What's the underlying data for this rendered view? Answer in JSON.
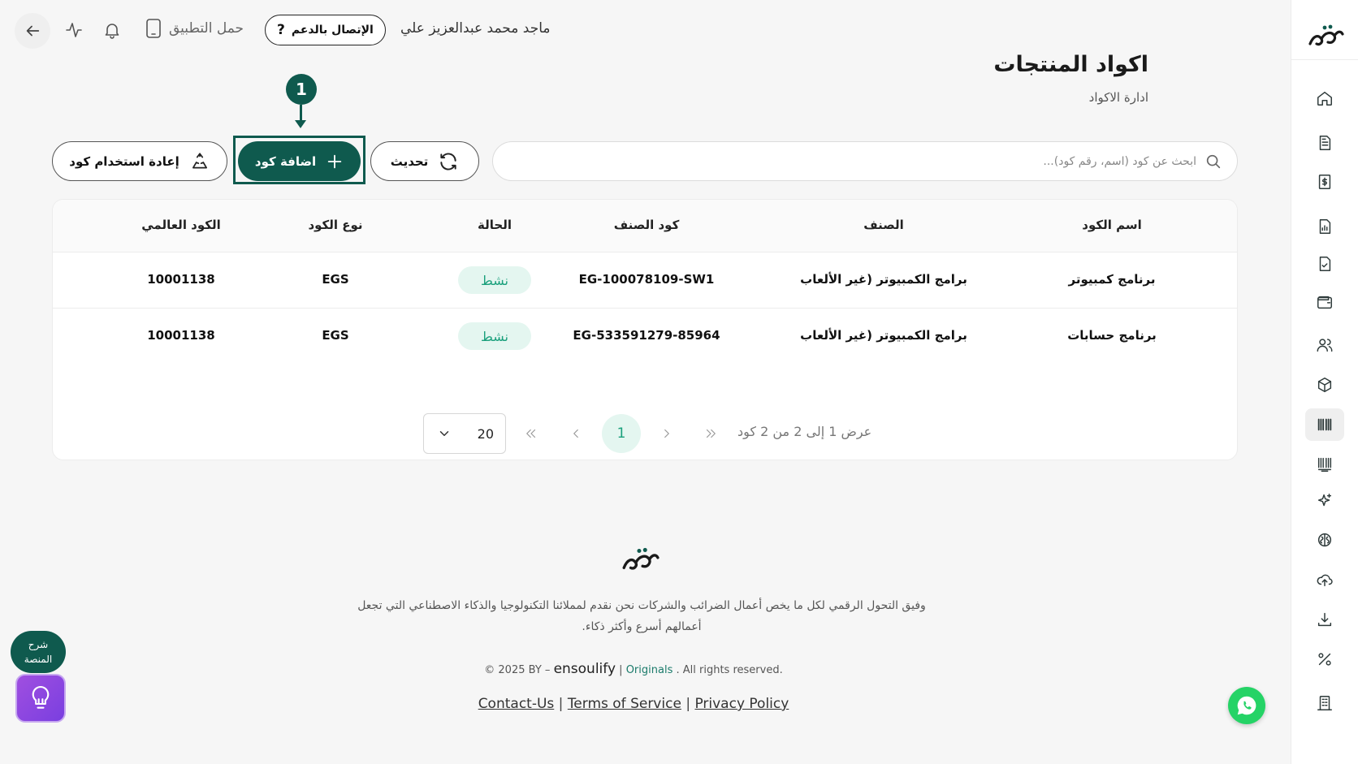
{
  "topbar": {
    "download_app_label": "حمل التطبيق",
    "support_label": "الإتصال بالدعم",
    "user_name": "ماجد محمد عبدالعزيز علي"
  },
  "header": {
    "title": "اكواد المنتجات",
    "subtitle": "ادارة الاكواد"
  },
  "step_marker": "1",
  "toolbar": {
    "search_placeholder": "ابحث عن كود (اسم، رقم كود)...",
    "refresh_label": "تحديث",
    "add_label": "اضافة كود",
    "reuse_label": "إعادة استخدام كود"
  },
  "table": {
    "columns": [
      "اسم الكود",
      "الصنف",
      "كود الصنف",
      "الحالة",
      "نوع الكود",
      "الكود العالمي"
    ],
    "rows": [
      {
        "name": "برنامج كمبيوتر",
        "category": "برامج الكمبيوتر (غير الألعاب",
        "item_code": "EG-100078109-SW1",
        "status": "نشط",
        "code_type": "EGS",
        "global_code": "10001138"
      },
      {
        "name": "برنامج حسابات",
        "category": "برامج الكمبيوتر (غير الألعاب",
        "item_code": "EG-533591279-85964",
        "status": "نشط",
        "code_type": "EGS",
        "global_code": "10001138"
      }
    ]
  },
  "pagination": {
    "page_size": "20",
    "current_page": "1",
    "info": "عرض 1 إلى 2 من 2 كود"
  },
  "footer": {
    "description": "وفيق التحول الرقمي لكل ما يخص أعمال الضرائب والشركات نحن نقدم لمملائنا التكنولوجيا والذكاء الاصطناعي التي تجعل أعمالهم أسرع وأكثر ذكاء.",
    "copyright_prefix": "© 2025 BY –",
    "brand": "ensoulify",
    "originals": "Originals",
    "rights": ". All rights reserved.",
    "links": [
      "Contact-Us",
      "Terms of Service",
      "Privacy Policy"
    ]
  },
  "floating": {
    "tour_label": "شرح المنصة"
  },
  "colors": {
    "primary": "#0f5a4e",
    "status_active_bg": "#e4f6f0",
    "status_active_text": "#1aa07c",
    "whatsapp": "#25d366"
  },
  "sidebar": {
    "items": [
      "home-icon",
      "invoice-icon",
      "receipt-icon",
      "report-icon",
      "document-check-icon",
      "wallet-icon",
      "users-icon",
      "box-icon",
      "barcode-icon",
      "barcode-scan-icon",
      "sparkle-icon",
      "brain-icon",
      "upload-cloud-icon",
      "download-icon",
      "percent-icon",
      "building-icon"
    ],
    "active": "barcode-icon"
  }
}
